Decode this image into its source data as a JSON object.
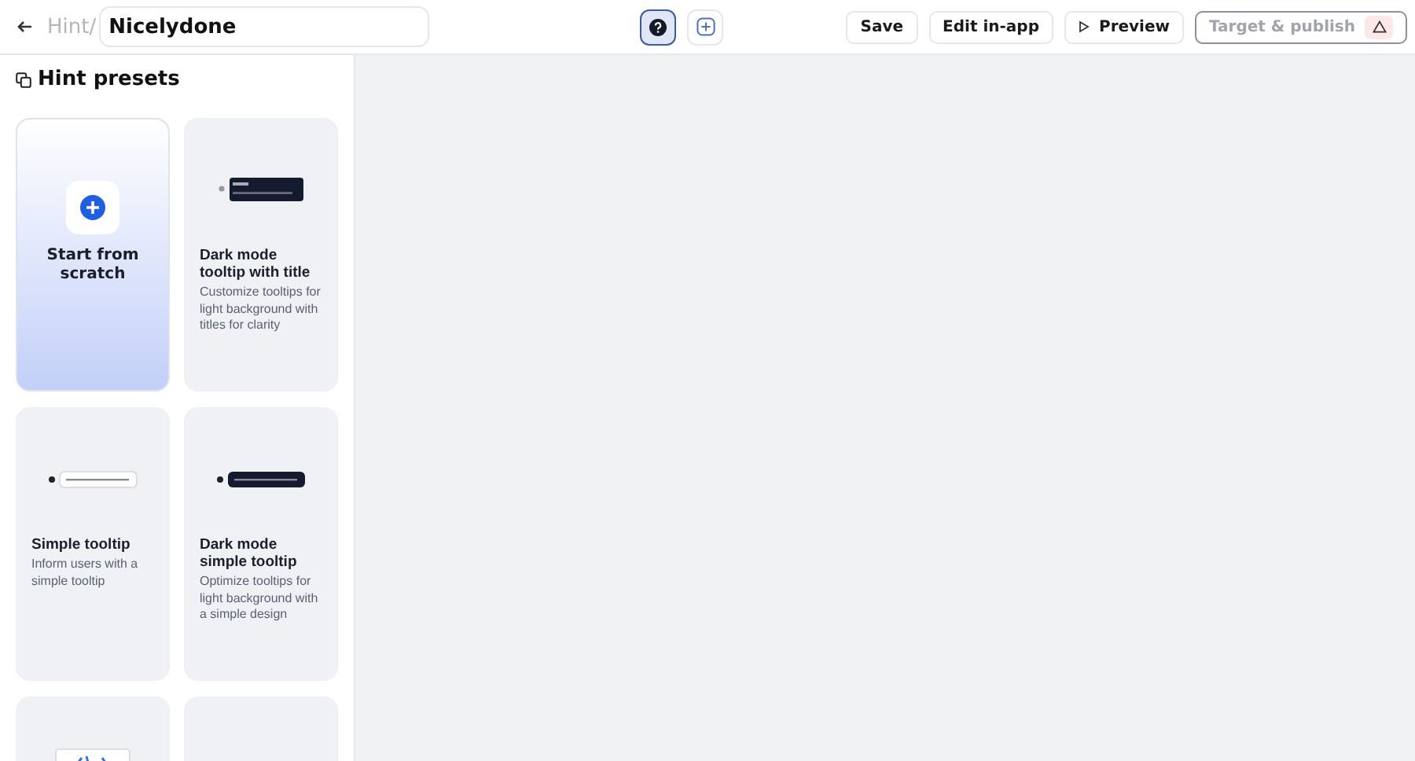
{
  "topbar": {
    "breadcrumb": "Hint/",
    "name": "Nicelydone",
    "modes": [
      {
        "kind": "help",
        "selected": true
      },
      {
        "kind": "add",
        "selected": false
      }
    ],
    "actions": [
      {
        "label": "Save",
        "kind": "plain",
        "disabled": false
      },
      {
        "label": "Edit in-app",
        "kind": "plain",
        "disabled": false
      },
      {
        "label": "Preview",
        "kind": "preview",
        "disabled": false
      },
      {
        "label": "Target & publish",
        "kind": "warning",
        "disabled": true
      }
    ]
  },
  "sidebar": {
    "title": "Hint presets",
    "presets": [
      {
        "kind": "new",
        "title": "Start from scratch"
      },
      {
        "kind": "dark-title",
        "title": "Dark mode tooltip with title",
        "description": "Customize tooltips for light background with titles for clarity"
      },
      {
        "kind": "light",
        "title": "Simple tooltip",
        "description": "Inform users with a simple tooltip"
      },
      {
        "kind": "dark",
        "title": "Dark mode simple tooltip",
        "description": "Optimize tooltips for light background with a simple design"
      },
      {
        "kind": "illustration"
      },
      {
        "kind": "card"
      }
    ]
  }
}
